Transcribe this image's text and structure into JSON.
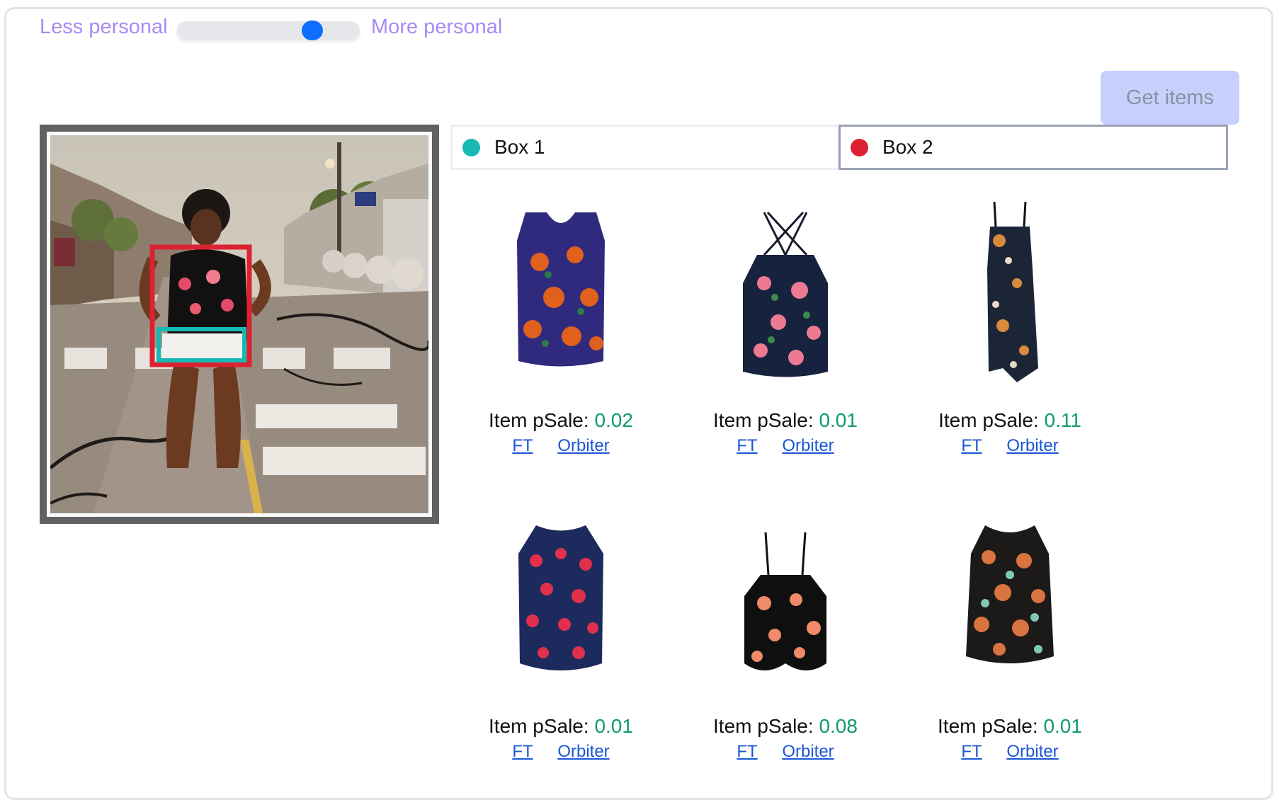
{
  "slider": {
    "less_label": "Less personal",
    "more_label": "More personal",
    "value_fraction": 0.77
  },
  "get_items_label": "Get items",
  "boxes": [
    {
      "label": "Box 1",
      "color": "#16b9b3"
    },
    {
      "label": "Box 2",
      "color": "#dc2232"
    }
  ],
  "selected_box": "Box 2",
  "items": [
    {
      "psale_label": "Item pSale:",
      "psale": "0.02",
      "link_ft": "FT",
      "link_orbiter": "Orbiter",
      "icon": "floral-sleeveless-top-icon"
    },
    {
      "psale_label": "Item pSale:",
      "psale": "0.01",
      "link_ft": "FT",
      "link_orbiter": "Orbiter",
      "icon": "floral-cami-top-icon"
    },
    {
      "psale_label": "Item pSale:",
      "psale": "0.11",
      "link_ft": "FT",
      "link_orbiter": "Orbiter",
      "icon": "floral-slip-dress-icon"
    },
    {
      "psale_label": "Item pSale:",
      "psale": "0.01",
      "link_ft": "FT",
      "link_orbiter": "Orbiter",
      "icon": "floral-blouse-icon"
    },
    {
      "psale_label": "Item pSale:",
      "psale": "0.08",
      "link_ft": "FT",
      "link_orbiter": "Orbiter",
      "icon": "floral-twist-cami-icon"
    },
    {
      "psale_label": "Item pSale:",
      "psale": "0.01",
      "link_ft": "FT",
      "link_orbiter": "Orbiter",
      "icon": "floral-tank-top-icon"
    }
  ],
  "colors": {
    "accent_label": "#a78bf5",
    "psale_value": "#0e9a6a",
    "link": "#1a57d6",
    "button_disabled": "#c7d0fd"
  }
}
